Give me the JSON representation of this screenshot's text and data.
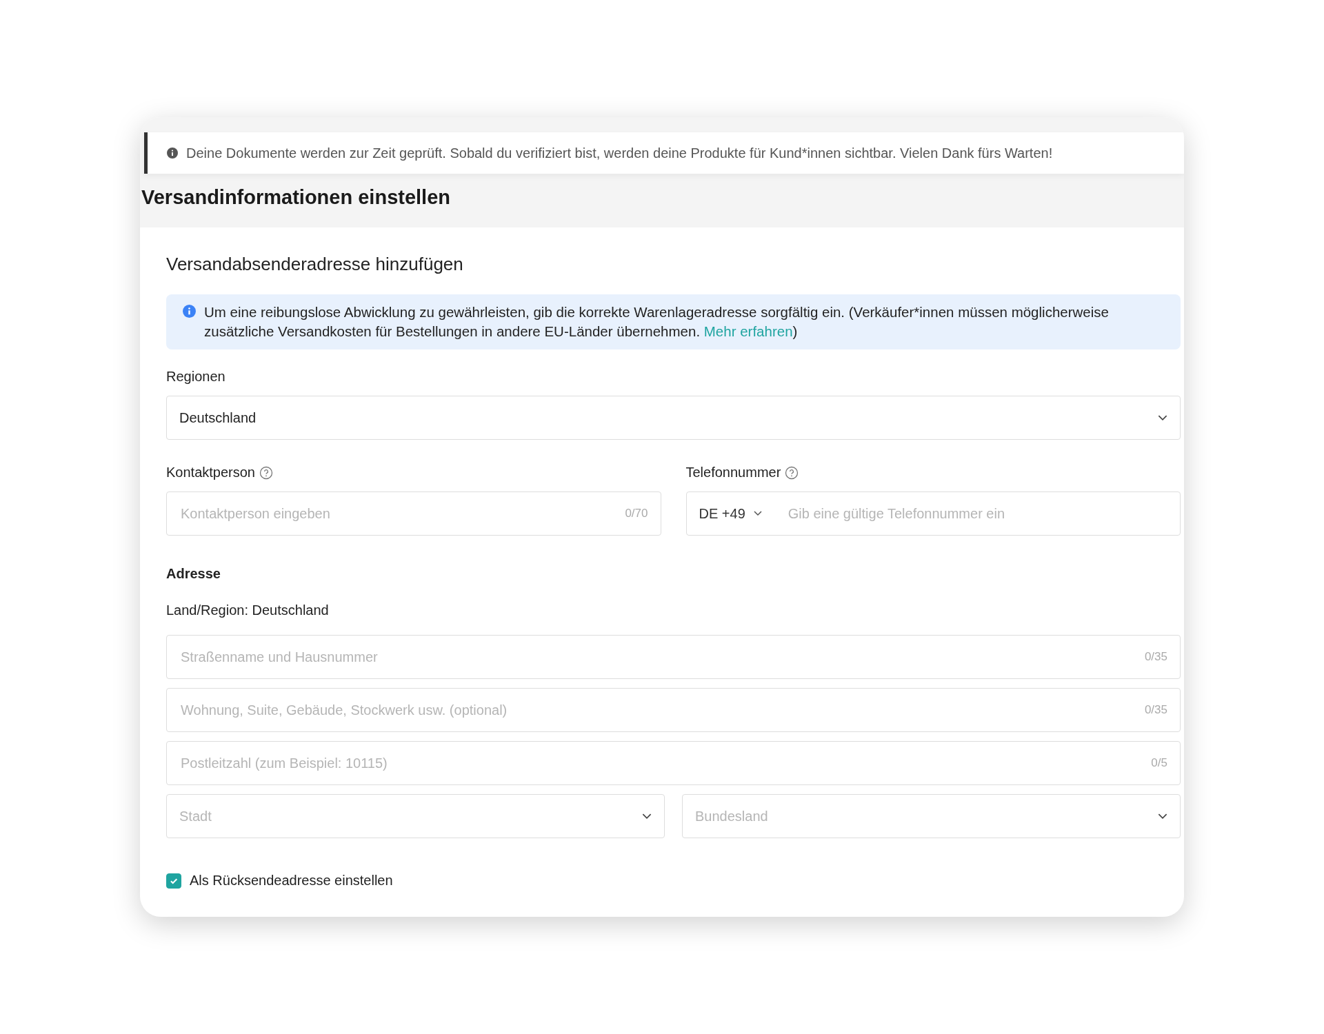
{
  "notice": {
    "text": "Deine Dokumente werden zur Zeit geprüft. Sobald du verifiziert bist, werden deine Produkte für Kund*innen sichtbar. Vielen Dank fürs Warten!"
  },
  "page_title": "Versandinformationen einstellen",
  "section": {
    "title": "Versandabsenderadresse hinzufügen",
    "info": {
      "text": "Um eine reibungslose Abwicklung zu gewährleisten, gib die korrekte Warenlageradresse sorgfältig ein. (Verkäufer*innen müssen möglicherweise zusätzliche Versandkosten für Bestellungen in andere EU-Länder übernehmen. ",
      "link": "Mehr erfahren",
      "after": ")"
    },
    "region": {
      "label": "Regionen",
      "value": "Deutschland"
    },
    "contact": {
      "label": "Kontaktperson",
      "placeholder": "Kontaktperson eingeben",
      "counter": "0/70"
    },
    "phone": {
      "label": "Telefonnummer",
      "code": "DE +49",
      "placeholder": "Gib eine gültige Telefonnummer ein"
    },
    "address": {
      "label": "Adresse",
      "country": "Land/Region: Deutschland",
      "fields": [
        {
          "placeholder": "Straßenname und Hausnummer",
          "counter": "0/35"
        },
        {
          "placeholder": "Wohnung, Suite, Gebäude, Stockwerk usw. (optional)",
          "counter": "0/35"
        },
        {
          "placeholder": "Postleitzahl (zum Beispiel: 10115)",
          "counter": "0/5"
        }
      ],
      "selects": [
        {
          "placeholder": "Stadt"
        },
        {
          "placeholder": "Bundesland"
        }
      ]
    },
    "return_address": {
      "label": "Als Rücksendeadresse einstellen",
      "checked": true
    }
  }
}
